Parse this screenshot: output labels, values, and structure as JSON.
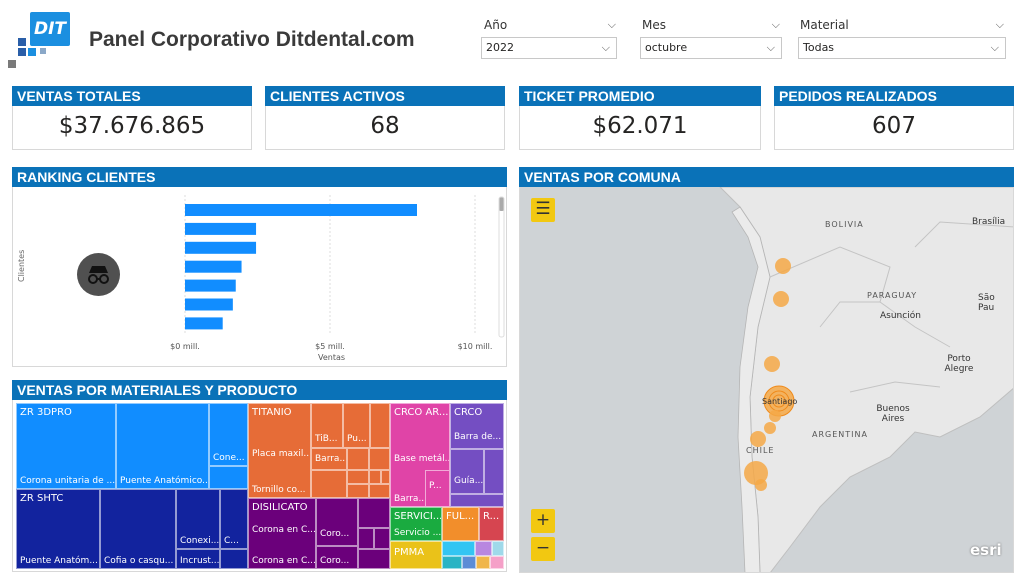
{
  "header": {
    "logo_text": "DIT",
    "title": "Panel Corporativo Ditdental.com"
  },
  "slicers": [
    {
      "label": "Año",
      "value": "2022"
    },
    {
      "label": "Mes",
      "value": "octubre"
    },
    {
      "label": "Material",
      "value": "Todas"
    }
  ],
  "kpis": [
    {
      "title": "VENTAS TOTALES",
      "value": "$37.676.865"
    },
    {
      "title": "CLIENTES ACTIVOS",
      "value": "68"
    },
    {
      "title": "TICKET PROMEDIO",
      "value": "$62.071"
    },
    {
      "title": "PEDIDOS REALIZADOS",
      "value": "607"
    }
  ],
  "ranking": {
    "title": "RANKING CLIENTES",
    "ylabel": "Clientes",
    "xlabel": "Ventas",
    "ticks": [
      "$0 mill.",
      "$5 mill.",
      "$10 mill."
    ]
  },
  "chart_data": {
    "type": "bar",
    "orientation": "horizontal",
    "title": "RANKING CLIENTES",
    "xlabel": "Ventas",
    "ylabel": "Clientes",
    "xlim": [
      0,
      10
    ],
    "unit": "mill.",
    "values": [
      8.0,
      2.45,
      2.45,
      1.95,
      1.75,
      1.65,
      1.3
    ],
    "color": "#118dff"
  },
  "treemap": {
    "title": "VENTAS POR MATERIALES Y PRODUCTO",
    "groups": [
      {
        "name": "ZR 3DPRO",
        "color": "#118dff",
        "products": [
          "Corona unitaria de ...",
          "Puente Anatómico...",
          "Cone..."
        ]
      },
      {
        "name": "ZR SHTC",
        "color": "#12239e",
        "products": [
          "Puente Anatóm...",
          "Cofia o casqu...",
          "Conexi...",
          "C...",
          "Incrust..."
        ]
      },
      {
        "name": "TITANIO",
        "color": "#e66c37",
        "products": [
          "Placa maxil...",
          "TiB...",
          "Pu...",
          "Barra...",
          "Tornillo co..."
        ]
      },
      {
        "name": "DISILICATO",
        "color": "#6b007b",
        "products": [
          "Corona en C...",
          "Coro...",
          "Corona en C...",
          "Coro..."
        ]
      },
      {
        "name": "CRCO AR...",
        "color": "#e044a7",
        "products": [
          "Base metál...",
          "P...",
          "Barra..."
        ]
      },
      {
        "name": "CRCO",
        "color": "#744ec2",
        "products": [
          "Barra de...",
          "Guía..."
        ]
      },
      {
        "name": "SERVICI...",
        "color": "#1aab40",
        "products": [
          "Servicio ..."
        ]
      },
      {
        "name": "FUL...",
        "color": "#f2c811",
        "products": []
      },
      {
        "name": "R...",
        "color": "#d64550",
        "products": []
      },
      {
        "name": "PMMA",
        "color": "#eac219",
        "products": []
      }
    ]
  },
  "map": {
    "title": "VENTAS POR COMUNA",
    "labels": {
      "bolivia": "BOLIVIA",
      "paraguay": "PARAGUAY",
      "argentina": "ARGENTINA",
      "chile": "CHILE",
      "brasilia": "Brasília",
      "sao_paulo": "São Pau",
      "asuncion": "Asunción",
      "porto_alegre": "Porto Alegre",
      "buenos_aires": "Buenos Aires",
      "santiago": "Santiago"
    },
    "attribution": "esri",
    "buttons": {
      "menu": "☰",
      "zoom_in": "+",
      "zoom_out": "−"
    }
  }
}
